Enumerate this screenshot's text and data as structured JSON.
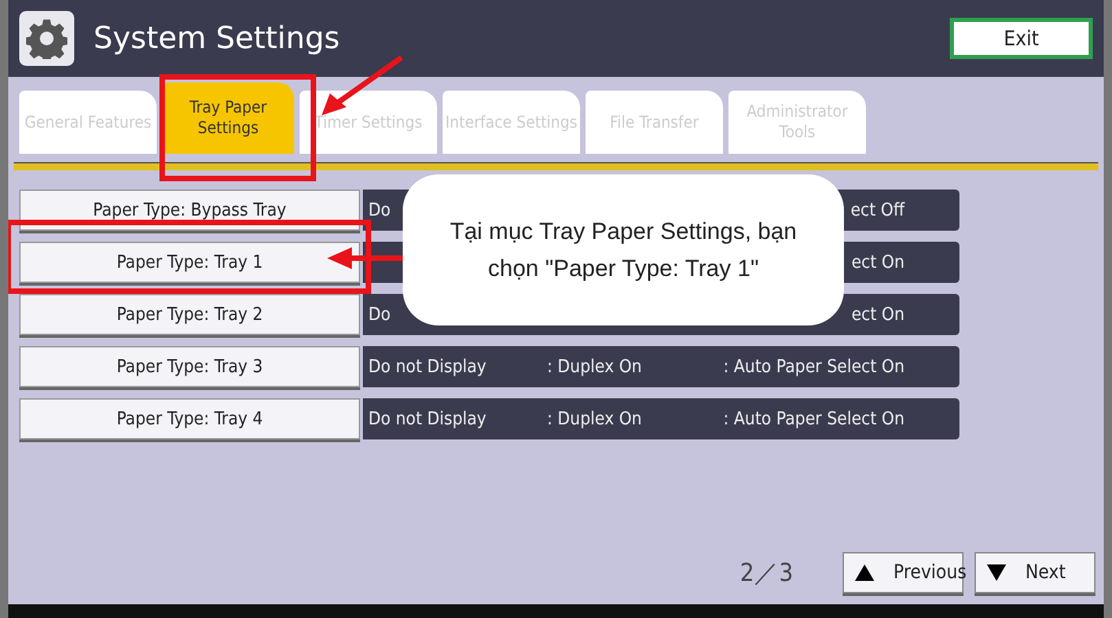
{
  "window": {
    "title": "System Settings",
    "exit_button": "Exit"
  },
  "tabs": [
    {
      "label": "General Features",
      "selected": false
    },
    {
      "label": "Tray Paper Settings",
      "selected": true
    },
    {
      "label": "Timer Settings",
      "selected": false
    },
    {
      "label": "Interface Settings",
      "selected": false
    },
    {
      "label": "File Transfer",
      "selected": false
    },
    {
      "label": "Administrator Tools",
      "selected": false
    }
  ],
  "rows": [
    {
      "button": "Paper Type: Bypass Tray",
      "display": "Do",
      "auto_select": "ect Off"
    },
    {
      "button": "Paper Type: Tray 1",
      "auto_select": "ect On"
    },
    {
      "button": "Paper Type: Tray 2",
      "display": "Do",
      "auto_select": "ect On"
    },
    {
      "button": "Paper Type: Tray 3",
      "display": "Do not Display",
      "duplex": ": Duplex On",
      "auto_select": ": Auto Paper Select On"
    },
    {
      "button": "Paper Type: Tray 4",
      "display": "Do not Display",
      "duplex": ": Duplex On",
      "auto_select": ": Auto Paper Select On"
    }
  ],
  "pager": {
    "page": "2／3",
    "previous": "Previous",
    "next": "Next"
  },
  "callout": {
    "text": "Tại mục Tray Paper Settings, bạn chọn \"Paper Type: Tray 1\""
  }
}
